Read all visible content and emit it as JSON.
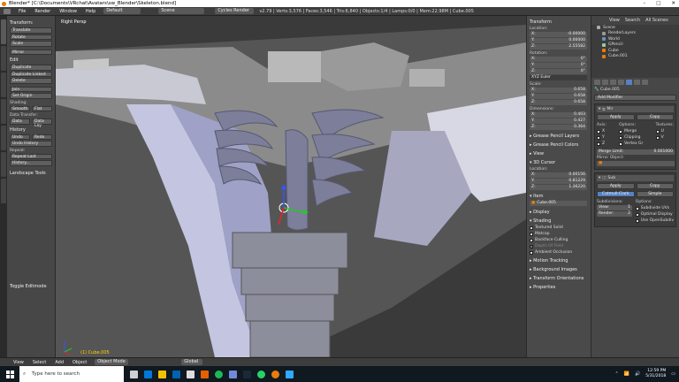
{
  "titlebar": {
    "text": "Blender* [C:\\Documents\\VRchat\\Avatars\\sw_Blender\\Skeleton.blend]"
  },
  "topbar": {
    "menus": [
      "File",
      "Render",
      "Window",
      "Help"
    ],
    "layout": "Default",
    "scene": "Scene",
    "engine": "Cycles Render",
    "stats": "v2.79 | Verts:3,576 | Faces:3,546 | Tris:6,840 | Objects:1/4 | Lamps:0/0 | Mem:22.98M | Cube.005"
  },
  "tools": {
    "transform_header": "Transform:",
    "translate": "Translate",
    "rotate": "Rotate",
    "scale": "Scale",
    "mirror": "Mirror",
    "edit_header": "Edit",
    "duplicate": "Duplicate",
    "duplicate_linked": "Duplicate Linked",
    "delete": "Delete",
    "join": "Join",
    "set_origin": "Set Origin",
    "shading_label": "Shading:",
    "smooth": "Smooth",
    "flat": "Flat",
    "data_transfer_label": "Data Transfer:",
    "data": "Data",
    "data_lay": "Data Lay",
    "history_header": "History",
    "undo": "Undo",
    "redo": "Redo",
    "undo_history": "Undo History",
    "repeat_label": "Repeat:",
    "repeat_last": "Repeat Last",
    "history": "History...",
    "landscape_tools": "Landscape Tools",
    "toggle_editmode": "Toggle Editmode"
  },
  "viewport": {
    "label": "Right Persp",
    "object": "(1) Cube.005"
  },
  "npanel": {
    "transform_header": "Transform",
    "location_label": "Location:",
    "location": [
      {
        "axis": "X:",
        "value": "-0.00000"
      },
      {
        "axis": "Y:",
        "value": "0.00000"
      },
      {
        "axis": "Z:",
        "value": "2.55582"
      }
    ],
    "rotation_label": "Rotation:",
    "rotation": [
      {
        "axis": "X:",
        "value": "0°"
      },
      {
        "axis": "Y:",
        "value": "0°"
      },
      {
        "axis": "Z:",
        "value": "0°"
      }
    ],
    "rotation_mode": "XYZ Euler",
    "scale_label": "Scale:",
    "scale": [
      {
        "axis": "X:",
        "value": "0.658"
      },
      {
        "axis": "Y:",
        "value": "0.658"
      },
      {
        "axis": "Z:",
        "value": "0.658"
      }
    ],
    "dimensions_label": "Dimensions:",
    "dimensions": [
      {
        "axis": "X:",
        "value": "0.403"
      },
      {
        "axis": "Y:",
        "value": "0.427"
      },
      {
        "axis": "Z:",
        "value": "0.364"
      }
    ],
    "grease_pencil_layers": "Grease Pencil Layers",
    "grease_pencil_colors": "Grease Pencil Colors",
    "view": "View",
    "cursor_header": "3D Cursor",
    "cursor_location_label": "Location:",
    "cursor": [
      {
        "axis": "X:",
        "value": "0.00156"
      },
      {
        "axis": "Y:",
        "value": "0.81229"
      },
      {
        "axis": "Z:",
        "value": "1.36220"
      }
    ],
    "item_header": "Item",
    "item_name": "Cube.005",
    "display": "Display",
    "shading": "Shading",
    "textured_solid": "Textured Solid",
    "matcap": "Matcap",
    "backface_culling": "Backface Culling",
    "depth_of_field": "Depth Of Field",
    "ambient_occlusion": "Ambient Occlusion",
    "motion_tracking": "Motion Tracking",
    "background_images": "Background Images",
    "transform_orientations": "Transform Orientations",
    "properties": "Properties"
  },
  "outliner": {
    "tabs": [
      "View",
      "Search",
      "All Scenes"
    ],
    "items": [
      "Scene",
      "RenderLayers",
      "World",
      "GPencil",
      "Cube",
      "Cube.001"
    ]
  },
  "props": {
    "object_name": "Cube.005",
    "add_modifier": "Add Modifier",
    "mirror": {
      "name": "Mir",
      "apply": "Apply",
      "copy": "Copy",
      "axis_label": "Axis:",
      "options_label": "Options:",
      "textures_label": "Textures:",
      "x": "X",
      "y": "Y",
      "z": "Z",
      "merge": "Merge",
      "clipping": "Clipping",
      "vertex_gr": "Vertex Gr",
      "u": "U",
      "v": "V",
      "merge_limit_label": "Merge Limit:",
      "merge_limit": "0.001000",
      "mirror_object_label": "Mirror Object:"
    },
    "subsurf": {
      "name": "Sub",
      "apply": "Apply",
      "copy": "Copy",
      "catmull": "Catmull-Clark",
      "simple": "Simple",
      "subdivisions_label": "Subdivisions:",
      "options_label": "Options:",
      "view_label": "View:",
      "view_val": "1",
      "render_label": "Render:",
      "render_val": "2",
      "subdivide_uvs": "Subdivide UVs",
      "optimal_display": "Optimal Display",
      "use_opensubdiv": "Use OpenSubdiv"
    }
  },
  "bottombar": {
    "view": "View",
    "select": "Select",
    "add": "Add",
    "object": "Object",
    "mode": "Object Mode",
    "orientation": "Global"
  },
  "taskbar": {
    "search_placeholder": "Type here to search",
    "time": "12:59 PM",
    "date": "5/31/2018"
  },
  "colors": {
    "accent": "#5680c2",
    "selected_orange": "#e87d0d",
    "object_yellow": "#ffd400"
  }
}
